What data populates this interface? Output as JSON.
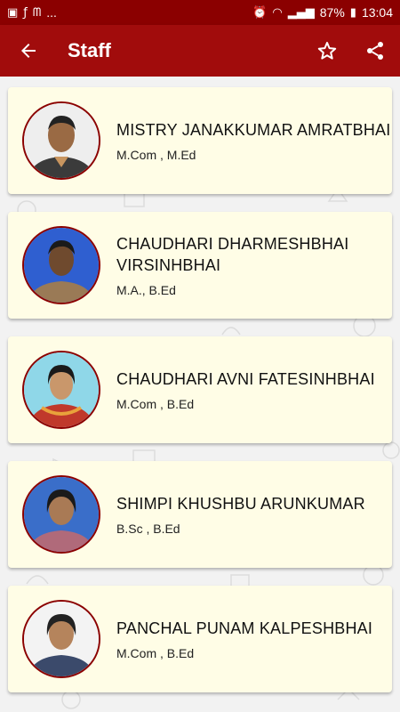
{
  "status_bar": {
    "carrier": "...",
    "battery": "87%",
    "time": "13:04"
  },
  "app_bar": {
    "title": "Staff",
    "icons": [
      "arrow-back-icon",
      "star-outline-icon",
      "share-icon"
    ]
  },
  "staff": [
    {
      "name": "MISTRY JANAKKUMAR AMRATBHAI",
      "qualification": "M.Com , M.Ed"
    },
    {
      "name": "CHAUDHARI DHARMESHBHAI VIRSINHBHAI",
      "qualification": "M.A., B.Ed"
    },
    {
      "name": "CHAUDHARI AVNI FATESINHBHAI",
      "qualification": "M.Com , B.Ed"
    },
    {
      "name": "SHIMPI KHUSHBU ARUNKUMAR",
      "qualification": "B.Sc , B.Ed"
    },
    {
      "name": "PANCHAL PUNAM KALPESHBHAI",
      "qualification": "M.Com , B.Ed"
    }
  ],
  "colors": {
    "status_bar": "#8b0000",
    "app_bar": "#a10c0c",
    "card_background": "#fffde6",
    "avatar_border": "#8b0000"
  }
}
